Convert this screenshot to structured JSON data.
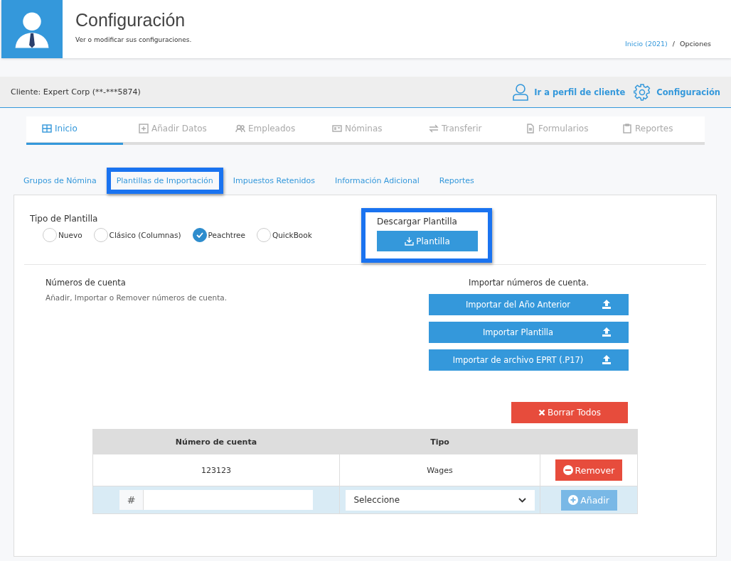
{
  "header": {
    "title": "Configuración",
    "subtitle": "Ver o modificar sus configuraciones.",
    "breadcrumb": [
      {
        "label": "Inicio (2021)",
        "link": true
      },
      {
        "label": "Opciones",
        "link": false
      }
    ],
    "separator": "/"
  },
  "client_bar": {
    "client": "Cliente: Expert Corp (**-***5874)",
    "actions": [
      {
        "kind": "user",
        "label": "Ir a perfil de cliente"
      },
      {
        "kind": "gear",
        "label": "Configuración"
      }
    ]
  },
  "main_tabs": [
    {
      "kind": "grid",
      "label": "Inicio",
      "selected": true
    },
    {
      "kind": "plus",
      "label": "Añadir Datos",
      "selected": false
    },
    {
      "kind": "users",
      "label": "Empleados",
      "selected": false
    },
    {
      "kind": "card",
      "label": "Nóminas",
      "selected": false
    },
    {
      "kind": "swap",
      "label": "Transferir",
      "selected": false
    },
    {
      "kind": "doc",
      "label": "Formularios",
      "selected": false
    },
    {
      "kind": "clipboard",
      "label": "Reportes",
      "selected": false
    }
  ],
  "sub_tabs": [
    {
      "label": "Grupos de Nómina",
      "highlighted": false
    },
    {
      "label": "Plantillas de Importación",
      "highlighted": true
    },
    {
      "label": "Impuestos Retenidos",
      "highlighted": false
    },
    {
      "label": "Información Adicional",
      "highlighted": false
    },
    {
      "label": "Reportes",
      "highlighted": false
    }
  ],
  "template_type": {
    "label": "Tipo de Plantilla",
    "options": [
      {
        "label": "Nuevo",
        "checked": false
      },
      {
        "label": "Clásico (Columnas)",
        "checked": false
      },
      {
        "label": "Peachtree",
        "checked": true
      },
      {
        "label": "QuickBook",
        "checked": false
      }
    ]
  },
  "download": {
    "label": "Descargar Plantilla",
    "button": "Plantilla",
    "highlighted": true
  },
  "accounts": {
    "title": "Números de cuenta",
    "description": "Añadir, Importar o Remover números de cuenta."
  },
  "import": {
    "title": "Importar números de cuenta.",
    "buttons": [
      "Importar del Año Anterior",
      "Importar Plantilla",
      "Importar de archivo EPRT (.P17)"
    ]
  },
  "clear_button": "Borrar Todos",
  "table": {
    "columns": [
      "Número de cuenta",
      "Tipo"
    ],
    "rows": [
      {
        "account": "123123",
        "type": "Wages",
        "button": "Remover"
      }
    ],
    "new_row": {
      "prefix": "#",
      "select": "Seleccione",
      "button": "Añadir",
      "disabled": true
    }
  }
}
